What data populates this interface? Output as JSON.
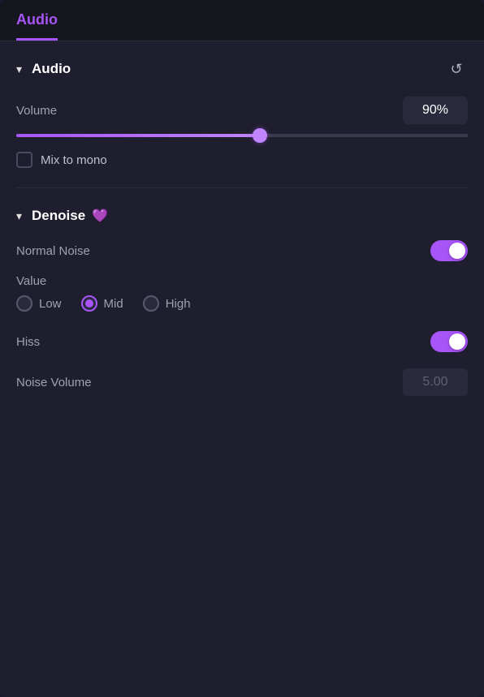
{
  "window": {
    "title": "Audio"
  },
  "audio_section": {
    "title": "Audio",
    "reset_label": "↺",
    "volume_label": "Volume",
    "volume_value": "90%",
    "volume_percent": 90,
    "slider_fill_percent": 54,
    "mix_to_mono_label": "Mix to mono",
    "mix_to_mono_checked": false
  },
  "denoise_section": {
    "title": "Denoise",
    "badge": "💜",
    "normal_noise_label": "Normal Noise",
    "normal_noise_on": true,
    "value_label": "Value",
    "radio_options": [
      {
        "id": "low",
        "label": "Low",
        "selected": false
      },
      {
        "id": "mid",
        "label": "Mid",
        "selected": true
      },
      {
        "id": "high",
        "label": "High",
        "selected": false
      }
    ],
    "hiss_label": "Hiss",
    "hiss_on": true,
    "noise_volume_label": "Noise Volume",
    "noise_volume_value": "5.00"
  }
}
